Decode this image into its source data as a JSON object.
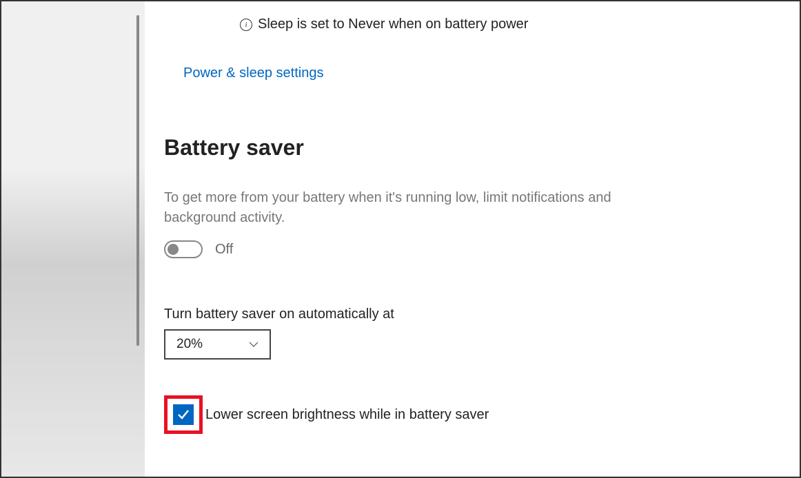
{
  "info": {
    "text": "Sleep is set to Never when on battery power"
  },
  "link": {
    "power_sleep": "Power & sleep settings"
  },
  "battery_saver": {
    "heading": "Battery saver",
    "description": "To get more from your battery when it's running low, limit notifications and background activity.",
    "toggle_state": "Off",
    "auto_label": "Turn battery saver on automatically at",
    "threshold": "20%",
    "brightness_label": "Lower screen brightness while in battery saver",
    "brightness_checked": true
  },
  "colors": {
    "accent": "#0067c0",
    "highlight": "#e81123"
  }
}
